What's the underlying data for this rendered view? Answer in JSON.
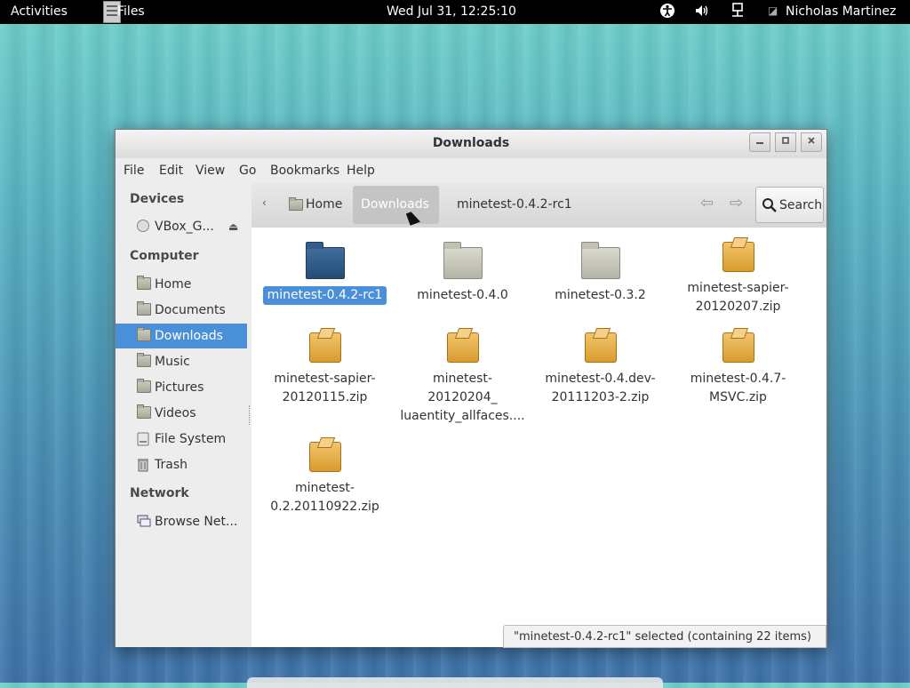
{
  "topbar": {
    "activities": "Activities",
    "app_name": "Files",
    "clock": "Wed Jul 31, 12:25:10",
    "user": "Nicholas Martinez"
  },
  "window": {
    "title": "Downloads"
  },
  "menubar": {
    "items": [
      "File",
      "Edit",
      "View",
      "Go",
      "Bookmarks",
      "Help"
    ]
  },
  "sidebar": {
    "sections": {
      "devices": "Devices",
      "computer": "Computer",
      "network": "Network"
    },
    "devices": [
      {
        "label": "VBox_G...",
        "icon": "disk-icon"
      }
    ],
    "computer": [
      {
        "label": "Home",
        "icon": "folder-icon"
      },
      {
        "label": "Documents",
        "icon": "folder-icon"
      },
      {
        "label": "Downloads",
        "icon": "folder-icon",
        "selected": true
      },
      {
        "label": "Music",
        "icon": "folder-icon"
      },
      {
        "label": "Pictures",
        "icon": "folder-icon"
      },
      {
        "label": "Videos",
        "icon": "folder-icon"
      },
      {
        "label": "File System",
        "icon": "harddrive-icon"
      },
      {
        "label": "Trash",
        "icon": "trash-icon"
      }
    ],
    "network": [
      {
        "label": "Browse Net...",
        "icon": "network-icon"
      }
    ]
  },
  "toolbar": {
    "breadcrumbs": [
      "Home",
      "Downloads",
      "minetest-0.4.2-rc1"
    ],
    "search_label": "Search"
  },
  "files": [
    {
      "name": "minetest-0.4.2-rc1",
      "type": "folder",
      "selected": true
    },
    {
      "name": "minetest-0.4.0",
      "type": "folder"
    },
    {
      "name": "minetest-0.3.2",
      "type": "folder"
    },
    {
      "name": "minetest-sapier-20120207.zip",
      "name_lines": [
        "minetest-sapier-",
        "20120207.zip"
      ],
      "type": "zip"
    },
    {
      "name": "minetest-sapier-20120115.zip",
      "name_lines": [
        "minetest-sapier-",
        "20120115.zip"
      ],
      "type": "zip"
    },
    {
      "name_lines": [
        "minetest-",
        "20120204_",
        "luaentity_allfaces...."
      ],
      "type": "zip"
    },
    {
      "name": "minetest-0.4.dev-20111203-2.zip",
      "name_lines": [
        "minetest-0.4.dev-",
        "20111203-2.zip"
      ],
      "type": "zip"
    },
    {
      "name": "minetest-0.4.7-MSVC.zip",
      "name_lines": [
        "minetest-0.4.7-",
        "MSVC.zip"
      ],
      "type": "zip"
    },
    {
      "name": "minetest-0.2.20110922.zip",
      "name_lines": [
        "minetest-",
        "0.2.20110922.zip"
      ],
      "type": "zip"
    }
  ],
  "status": "\"minetest-0.4.2-rc1\" selected (containing 22 items)",
  "colors": {
    "selection": "#4a90d9",
    "topbar": "#000000",
    "window_bg": "#ededed"
  }
}
